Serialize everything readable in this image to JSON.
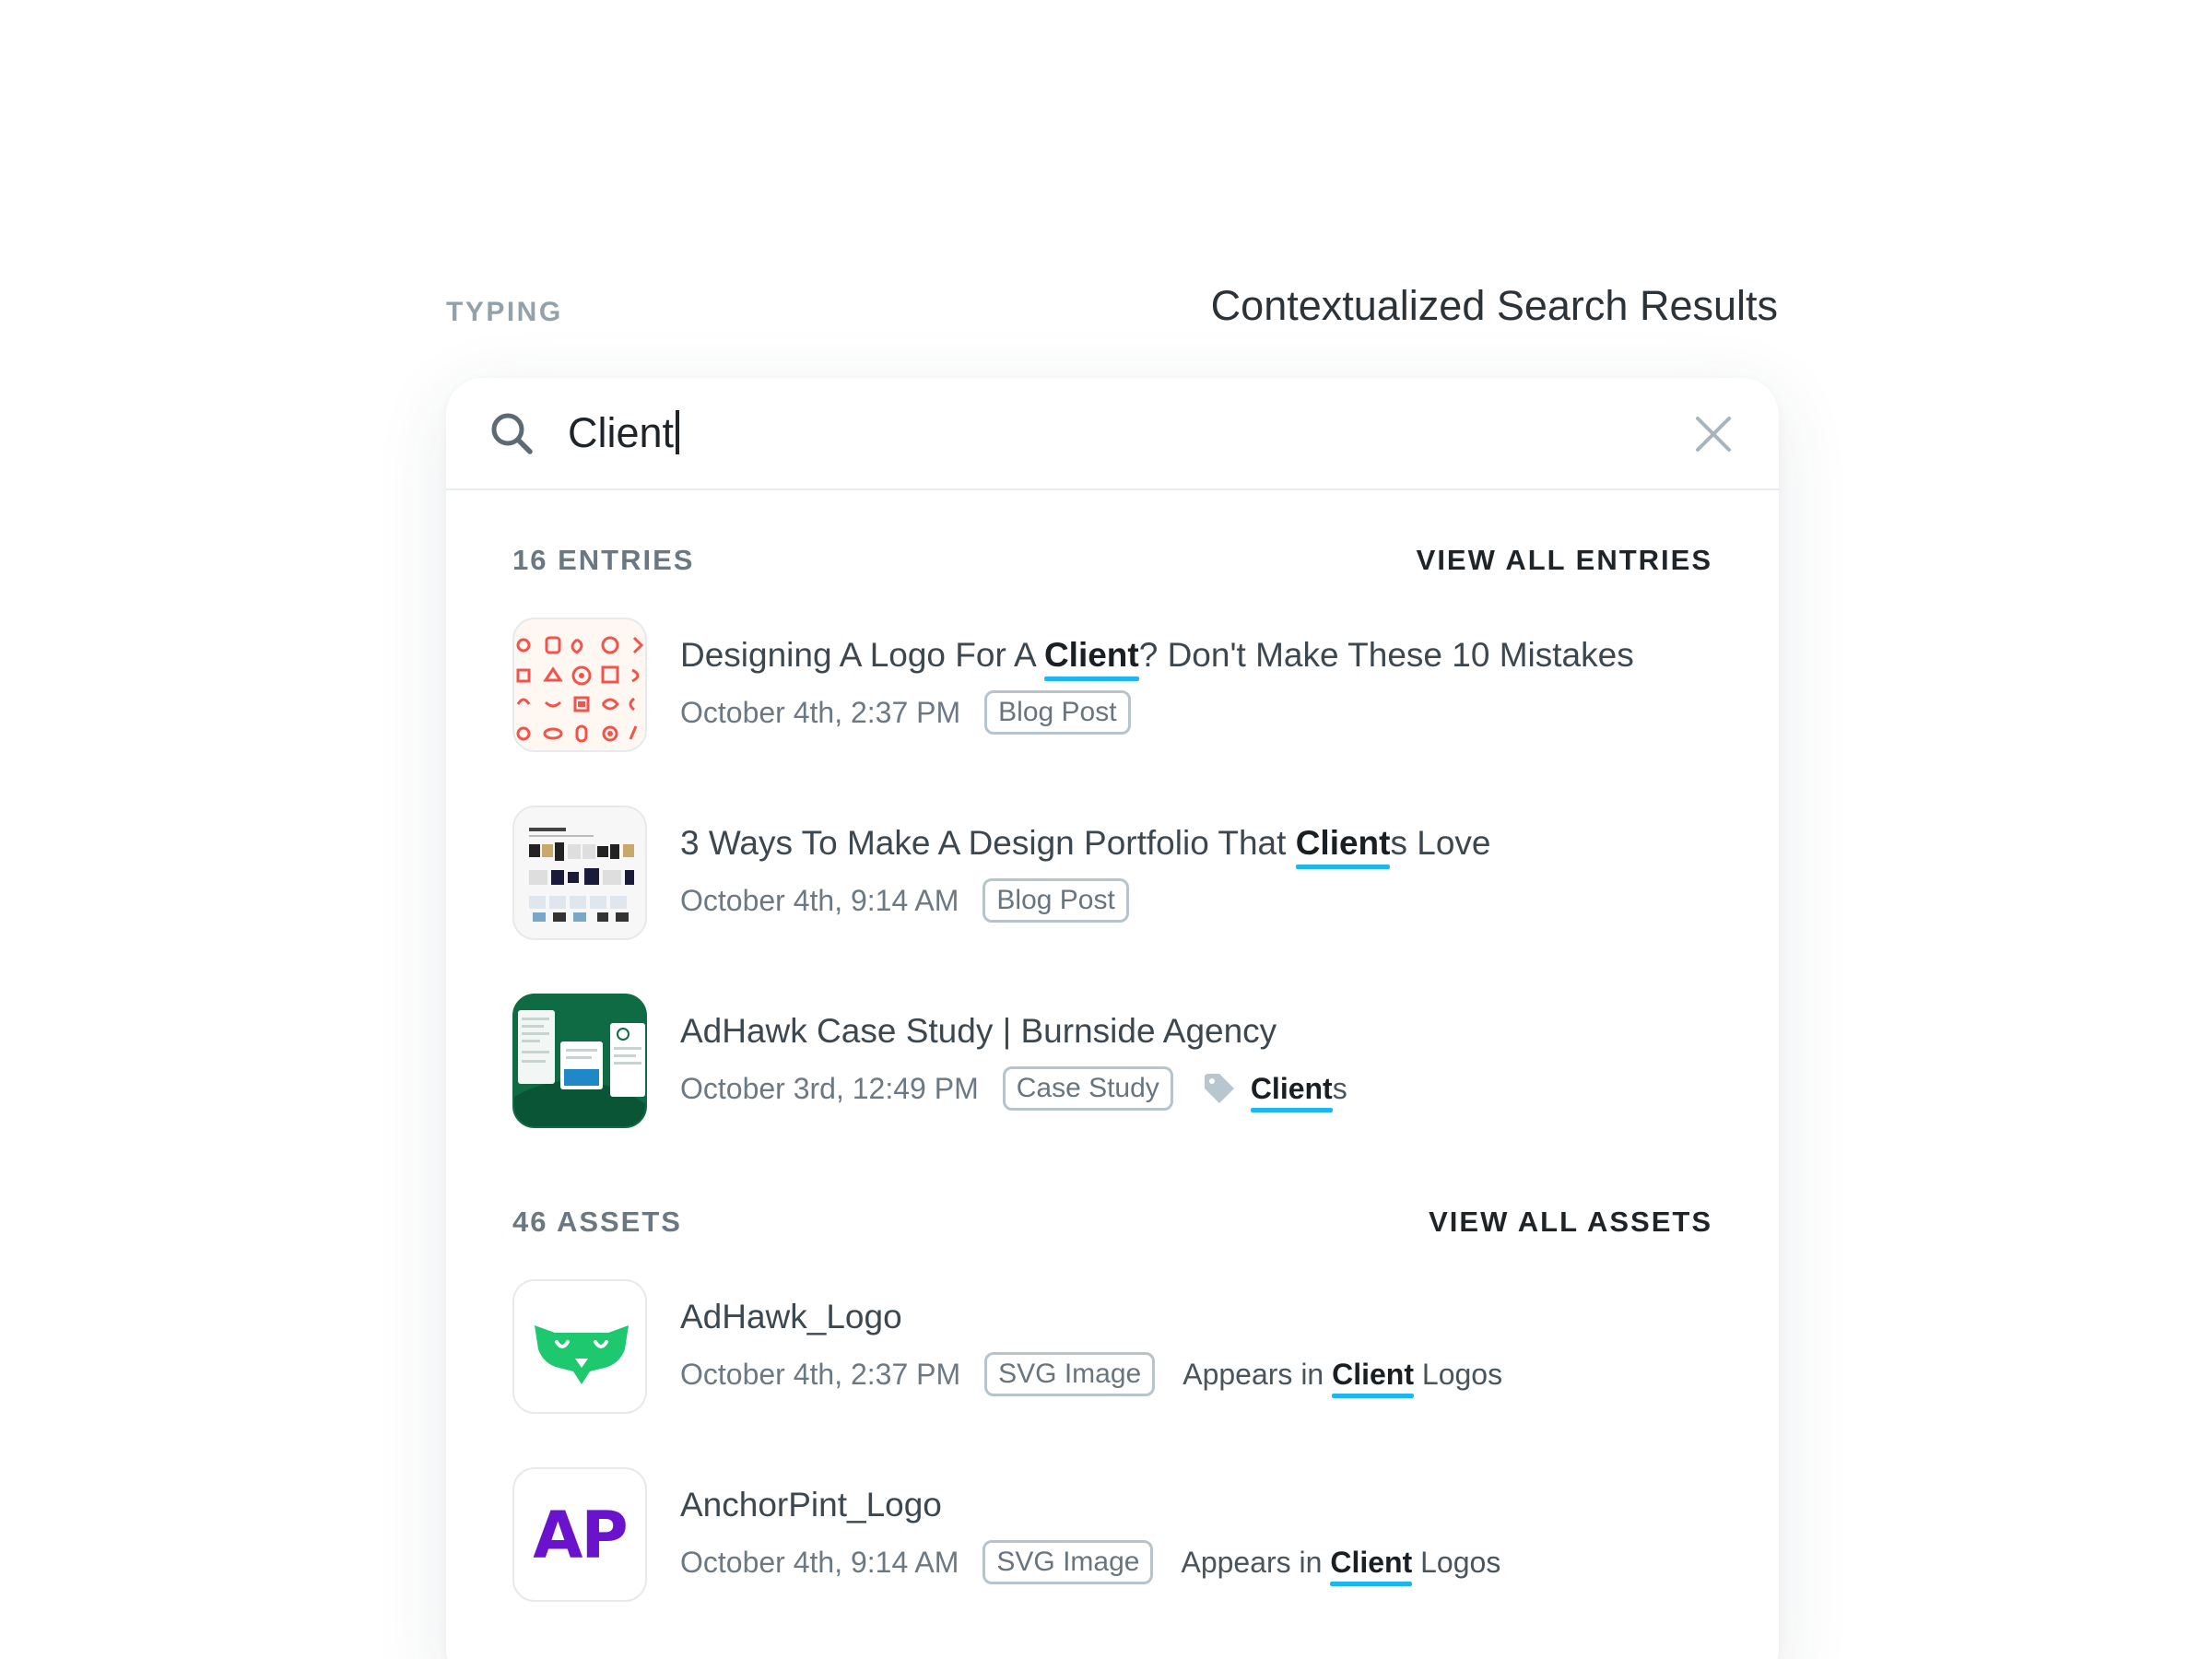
{
  "mode_label": "TYPING",
  "page_title": "Contextualized Search Results",
  "search": {
    "value": "Client"
  },
  "sections": {
    "entries": {
      "count_label": "16 ENTRIES",
      "link_label": "VIEW ALL ENTRIES",
      "items": [
        {
          "title_before": "Designing A Logo For A ",
          "title_match": "Client",
          "title_after": "? Don't Make These 10 Mistakes",
          "date": "October 4th, 2:37 PM",
          "type": "Blog Post"
        },
        {
          "title_before": "3 Ways To Make A Design Portfolio That ",
          "title_match": "Client",
          "title_after": "s Love",
          "date": "October 4th, 9:14 AM",
          "type": "Blog Post"
        },
        {
          "title": "AdHawk Case Study | Burnside Agency",
          "date": "October 3rd, 12:49 PM",
          "type": "Case Study",
          "tag_match": "Client",
          "tag_rest": "s"
        }
      ]
    },
    "assets": {
      "count_label": "46 ASSETS",
      "link_label": "VIEW ALL ASSETS",
      "items": [
        {
          "title": "AdHawk_Logo",
          "date": "October 4th, 2:37 PM",
          "type": "SVG Image",
          "appears_prefix": "Appears in ",
          "appears_match": "Client",
          "appears_rest": " Logos"
        },
        {
          "title": "AnchorPint_Logo",
          "thumb_text": "AP",
          "date": "October 4th, 9:14 AM",
          "type": "SVG Image",
          "appears_prefix": "Appears in ",
          "appears_match": "Client",
          "appears_rest": " Logos"
        }
      ]
    }
  },
  "colors": {
    "highlight_underline": "#1eb6f2",
    "adhawk_green": "#1ec86e",
    "case_study_green": "#0e6b43",
    "anchorpint_purple": "#6a12cc",
    "logo_grid_red": "#f0554c"
  }
}
